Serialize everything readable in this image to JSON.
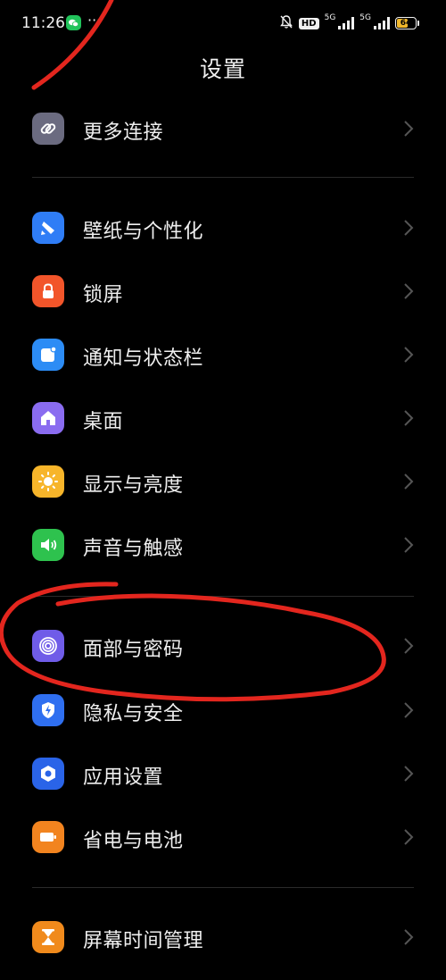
{
  "status_bar": {
    "time": "11:26",
    "more_indicator": "···",
    "hd_label": "HD",
    "network1": "5G",
    "network2": "5G",
    "battery_level": 64,
    "battery_text": "64"
  },
  "header": {
    "title": "设置"
  },
  "settings": {
    "items": [
      {
        "label": "更多连接",
        "icon": "link-icon",
        "color": "#6b6b80"
      },
      {
        "label": "壁纸与个性化",
        "icon": "brush-icon",
        "color": "#2f7df6"
      },
      {
        "label": "锁屏",
        "icon": "lock-icon",
        "color": "#f2552a"
      },
      {
        "label": "通知与状态栏",
        "icon": "notification-icon",
        "color": "#2c8cf5"
      },
      {
        "label": "桌面",
        "icon": "home-icon",
        "color": "#8a6cf0"
      },
      {
        "label": "显示与亮度",
        "icon": "sun-icon",
        "color": "#f7b52a"
      },
      {
        "label": "声音与触感",
        "icon": "speaker-icon",
        "color": "#2ec24e"
      },
      {
        "label": "面部与密码",
        "icon": "face-id-icon",
        "color": "#6f5ce8"
      },
      {
        "label": "隐私与安全",
        "icon": "shield-icon",
        "color": "#2f6ff0"
      },
      {
        "label": "应用设置",
        "icon": "app-settings-icon",
        "color": "#2a64e8"
      },
      {
        "label": "省电与电池",
        "icon": "battery-icon",
        "color": "#f2841f"
      },
      {
        "label": "屏幕时间管理",
        "icon": "hourglass-icon",
        "color": "#f08a1c"
      }
    ]
  },
  "colors": {
    "background": "#000000",
    "text": "#efefef",
    "divider": "#2a2a2a",
    "annotation": "#e3261e"
  }
}
